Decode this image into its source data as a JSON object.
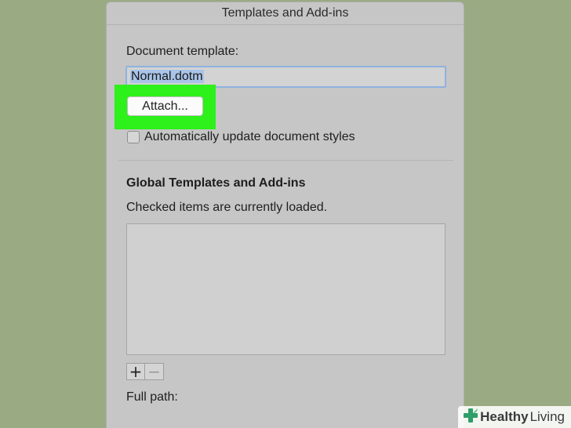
{
  "dialog": {
    "title": "Templates and Add-ins",
    "document_template_label": "Document template:",
    "document_template_value": "Normal.dotm",
    "attach_label": "Attach...",
    "auto_update_label": "Automatically update document styles",
    "auto_update_checked": false,
    "global_heading": "Global Templates and Add-ins",
    "global_subtext": "Checked items are currently loaded.",
    "addins_items": [],
    "add_symbol": "+",
    "remove_symbol": "−",
    "full_path_label": "Full path:"
  },
  "highlight_color": "#2ef01b",
  "watermark": {
    "brand_bold": "Healthy",
    "brand_regular": "Living",
    "logo_icon": "cross-leaf-icon"
  }
}
